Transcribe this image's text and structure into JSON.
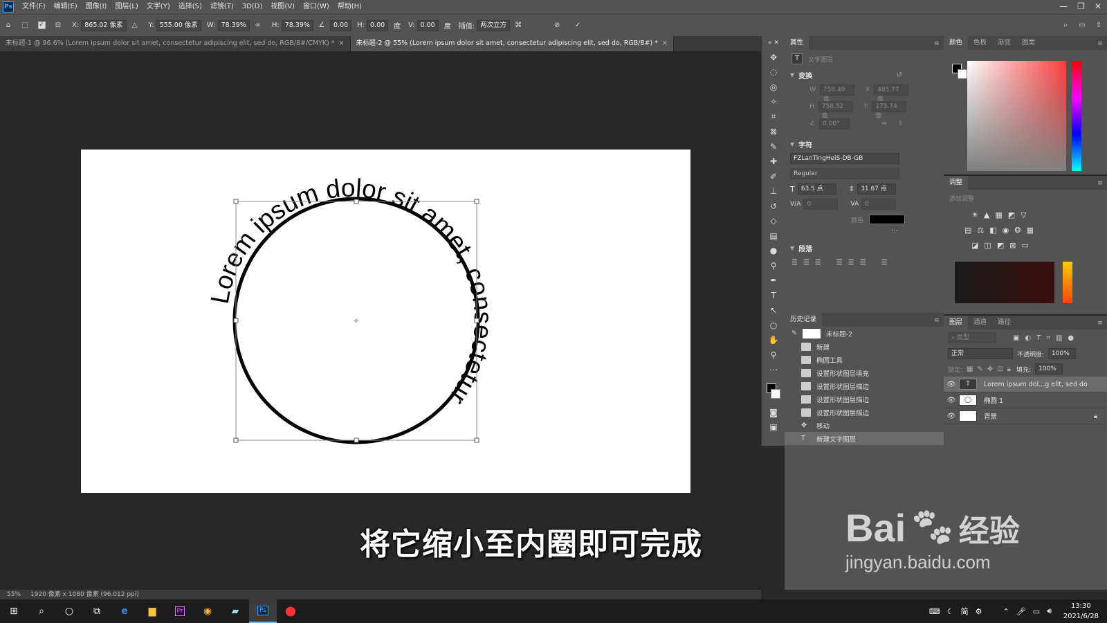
{
  "menubar": {
    "logo": "Ps",
    "items": [
      "文件(F)",
      "编辑(E)",
      "图像(I)",
      "图层(L)",
      "文字(Y)",
      "选择(S)",
      "滤镜(T)",
      "3D(D)",
      "视图(V)",
      "窗口(W)",
      "帮助(H)"
    ]
  },
  "options": {
    "x_label": "X:",
    "x_value": "865.02 像素",
    "y_label": "Y:",
    "y_value": "555.00 像素",
    "w_label": "W:",
    "w_value": "78.39%",
    "h_label": "H:",
    "h_value": "78.39%",
    "angle_value": "0.00",
    "hskew_label": "H:",
    "hskew_value": "0.00",
    "deg1": "度",
    "vskew_label": "V:",
    "vskew_value": "0.00",
    "deg2": "度",
    "interp_label": "插值:",
    "interp_value": "两次立方"
  },
  "tabs": [
    {
      "label": "未标题-1 @ 96.6% (Lorem ipsum dolor sit amet, consectetur adipiscing elit, sed do, RGB/8#/CMYK) *"
    },
    {
      "label": "未标题-2 @ 55% (Lorem ipsum dolor sit amet, consectetur adipiscing elit, sed do, RGB/8#) *"
    }
  ],
  "canvas": {
    "circle_text": "Lorem ipsum dolor sit amet, consectetur "
  },
  "subtitle": "将它缩小至内圈即可完成",
  "status": {
    "zoom": "55%",
    "docinfo": "1920 像素 x 1080 像素 (96.012 ppi)"
  },
  "properties": {
    "tab": "属性",
    "layer_kind": "文字图层",
    "transform_title": "变换",
    "w_label": "W",
    "w_value": "758.49 像",
    "x_label": "X",
    "x_value": "485.77 像",
    "h_label": "H",
    "h_value": "758.52 像",
    "y_label": "Y",
    "y_value": "175.74 像",
    "angle_value": "0.00°",
    "char_title": "字符",
    "font": "FZLanTingHeiS-DB-GB",
    "style": "Regular",
    "size": "63.5 点",
    "leading": "31.67 点",
    "kerning": "0",
    "tracking": "0",
    "color_label": "颜色",
    "para_title": "段落"
  },
  "history": {
    "tab": "历史记录",
    "doc": "未标题-2",
    "items": [
      "新建",
      "椭圆工具",
      "设置形状图层填充",
      "设置形状图层描边",
      "设置形状图层描边",
      "设置形状图层描边",
      "移动",
      "新建文字图层"
    ]
  },
  "colorpanel": {
    "tabs": [
      "颜色",
      "色板",
      "渐变",
      "图案"
    ],
    "fg": "#000000",
    "bg": "#ffffff"
  },
  "adjust": {
    "tab": "调整",
    "add_label": "添加调整"
  },
  "layers": {
    "tabs": [
      "图层",
      "通道",
      "路径"
    ],
    "search": "类型",
    "blend": "正常",
    "opacity_label": "不透明度:",
    "opacity_value": "100%",
    "lock_label": "锁定:",
    "fill_label": "填充:",
    "fill_value": "100%",
    "items": [
      {
        "name": "Lorem ipsum dol...g elit, sed do",
        "kind": "T"
      },
      {
        "name": "椭圆 1",
        "kind": "shape"
      },
      {
        "name": "背景",
        "kind": "bg"
      }
    ]
  },
  "taskbar": {
    "time": "13:30",
    "date": "2021/6/28",
    "ime": "简"
  },
  "watermark": {
    "brand": "Bai",
    "brand2": "经验",
    "url": "jingyan.baidu.com"
  }
}
